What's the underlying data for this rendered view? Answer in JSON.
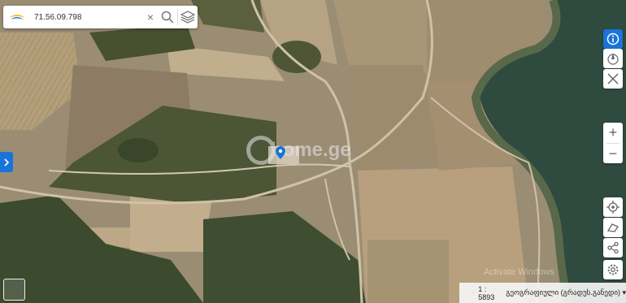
{
  "search": {
    "query": "71.56.09.798",
    "clear_glyph": "×"
  },
  "icons": {
    "logo": "georgia-map-logo",
    "search": "search-icon",
    "layers": "layers-icon",
    "info": "info-icon",
    "compass": "compass-icon",
    "measure": "measure-icon",
    "locate": "locate-icon",
    "draw": "draw-icon",
    "share": "share-icon",
    "settings": "settings-icon"
  },
  "zoom": {
    "in_label": "+",
    "out_label": "−"
  },
  "watermark": {
    "text": "home.ge"
  },
  "status": {
    "scale_prefix": "1 : ",
    "scale": "5893",
    "projection": "გეოგრაფიული (გრადუს.განედი) ▾"
  },
  "os_overlay": {
    "text": "Activate Windows"
  },
  "colors": {
    "accent": "#1a73d9",
    "water": "#2f4a3e"
  }
}
